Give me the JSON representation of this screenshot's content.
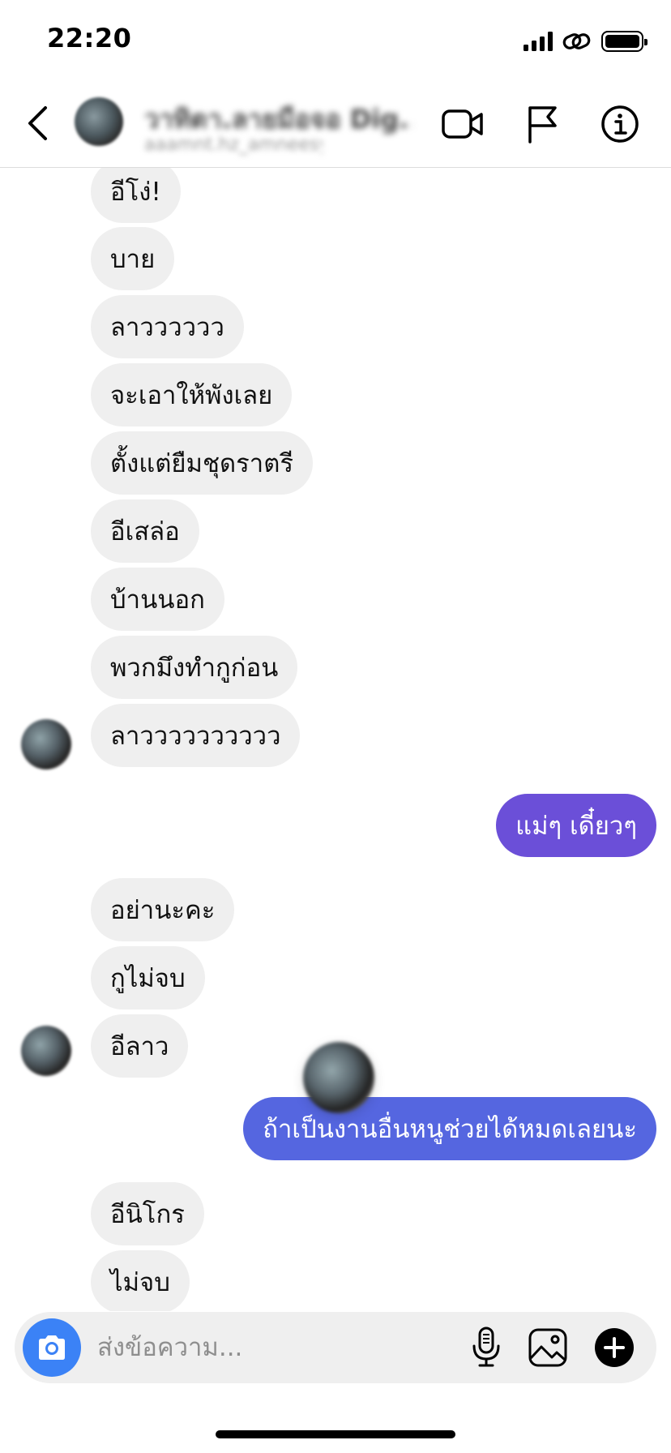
{
  "status_bar": {
    "time": "22:20"
  },
  "header": {
    "name": "วาทิตา.ลายมือจอ Dig...",
    "username": "aaamnt.hz_amneesy"
  },
  "messages": [
    {
      "side": "in",
      "text": "อีโง่!"
    },
    {
      "side": "in",
      "text": "บาย"
    },
    {
      "side": "in",
      "text": "ลาวววววว"
    },
    {
      "side": "in",
      "text": "จะเอาให้พังเลย"
    },
    {
      "side": "in",
      "text": "ตั้งแต่ยืมชุดราตรี"
    },
    {
      "side": "in",
      "text": "อีเสล่อ"
    },
    {
      "side": "in",
      "text": "บ้านนอก"
    },
    {
      "side": "in",
      "text": "พวกมึงทำกูก่อน"
    },
    {
      "side": "in",
      "text": "ลาวววววววววว",
      "avatar": true
    },
    {
      "side": "out",
      "text": "แม่ๆ เดี๋ยวๆ",
      "color": "#6b4fd8"
    },
    {
      "side": "in",
      "text": "อย่านะคะ"
    },
    {
      "side": "in",
      "text": "กูไม่จบ"
    },
    {
      "side": "in",
      "text": "อีลาว",
      "avatar": true
    },
    {
      "side": "out",
      "text": "ถ้าเป็นงานอื่นหนูช่วยได้หมดเลยนะ",
      "color": "#5566e0"
    },
    {
      "side": "in",
      "text": "อีนิโกร"
    },
    {
      "side": "in",
      "text": "ไม่จบ"
    }
  ],
  "composer": {
    "placeholder": "ส่งข้อความ..."
  },
  "colors": {
    "camera_button": "#3b82f6",
    "incoming_bubble": "#efefef"
  }
}
